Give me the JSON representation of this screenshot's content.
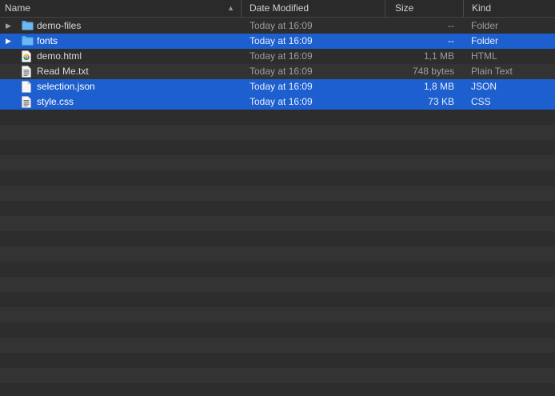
{
  "columns": {
    "name": "Name",
    "date_modified": "Date Modified",
    "size": "Size",
    "kind": "Kind"
  },
  "rows": [
    {
      "name": "demo-files",
      "date": "Today at 16:09",
      "size": "--",
      "kind": "Folder",
      "icon": "folder-icon",
      "expandable": true,
      "selected": false
    },
    {
      "name": "fonts",
      "date": "Today at 16:09",
      "size": "--",
      "kind": "Folder",
      "icon": "folder-icon",
      "expandable": true,
      "selected": true
    },
    {
      "name": "demo.html",
      "date": "Today at 16:09",
      "size": "1,1 MB",
      "kind": "HTML",
      "icon": "chrome-html-icon",
      "expandable": false,
      "selected": false
    },
    {
      "name": "Read Me.txt",
      "date": "Today at 16:09",
      "size": "748 bytes",
      "kind": "Plain Text",
      "icon": "text-document-icon",
      "expandable": false,
      "selected": false
    },
    {
      "name": "selection.json",
      "date": "Today at 16:09",
      "size": "1,8 MB",
      "kind": "JSON",
      "icon": "blank-document-icon",
      "expandable": false,
      "selected": true
    },
    {
      "name": "style.css",
      "date": "Today at 16:09",
      "size": "73 KB",
      "kind": "CSS",
      "icon": "text-document-icon",
      "expandable": false,
      "selected": true
    }
  ],
  "colors": {
    "selection": "#1d5fce",
    "row_odd": "#2d2d2d",
    "row_even": "#333333",
    "folder": "#5aa9e6"
  }
}
